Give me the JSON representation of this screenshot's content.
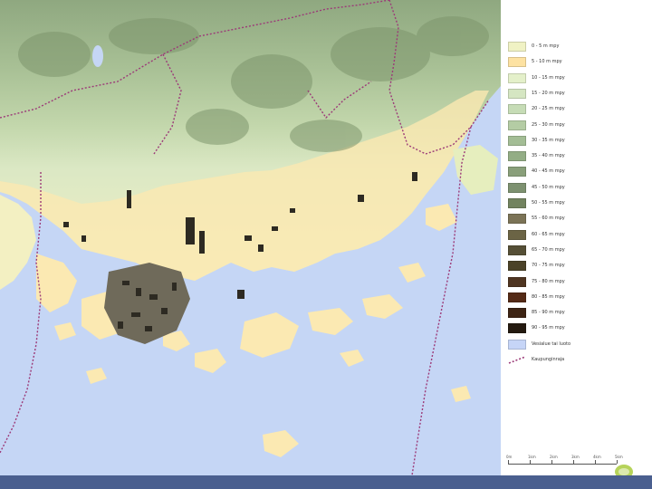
{
  "map": {
    "colors": {
      "water": "#c5d6f5",
      "coast_low": "#fbe9b2",
      "low_plain": "#f3f0c2",
      "green_1": "#dbe8c4",
      "green_2": "#c3d7ac",
      "green_3": "#a9c196",
      "green_4": "#8fa880",
      "buildings": "#2d2a22",
      "boundary": "#9c3a78"
    }
  },
  "legend": {
    "items": [
      {
        "label": "0 - 5 m mpy",
        "color": "#f0f2c4"
      },
      {
        "label": "5 - 10 m mpy",
        "color": "#fde2a2"
      },
      {
        "label": "10 - 15 m mpy",
        "color": "#e4f0ca"
      },
      {
        "label": "15 - 20 m mpy",
        "color": "#d5e6c2"
      },
      {
        "label": "20 - 25 m mpy",
        "color": "#c6dcb6"
      },
      {
        "label": "25 - 30 m mpy",
        "color": "#b4cca4"
      },
      {
        "label": "30 - 35 m mpy",
        "color": "#a3bd95"
      },
      {
        "label": "35 - 40 m mpy",
        "color": "#93ad85"
      },
      {
        "label": "40 - 45 m mpy",
        "color": "#899f7a"
      },
      {
        "label": "45 - 50 m mpy",
        "color": "#7d9170"
      },
      {
        "label": "50 - 55 m mpy",
        "color": "#72835f"
      },
      {
        "label": "55 - 60 m mpy",
        "color": "#7b7356"
      },
      {
        "label": "60 - 65 m mpy",
        "color": "#6b6445"
      },
      {
        "label": "65 - 70 m mpy",
        "color": "#554f36"
      },
      {
        "label": "70 - 75 m mpy",
        "color": "#4b4228"
      },
      {
        "label": "75 - 80 m mpy",
        "color": "#4f3521"
      },
      {
        "label": "80 - 85 m mpy",
        "color": "#542a16"
      },
      {
        "label": "85 - 90 m mpy",
        "color": "#3d2414"
      },
      {
        "label": "90 - 95 m mpy",
        "color": "#241a10"
      },
      {
        "label": "Vesialue tai luoto",
        "color": "#c6d5f7"
      },
      {
        "label": "Kaupunginraja",
        "color": "#9c3a78"
      }
    ]
  },
  "scale": {
    "labels": [
      "0m",
      "1km",
      "2km",
      "3km",
      "4km",
      "5km"
    ]
  },
  "footer": {
    "band_color": "#4a5f8f"
  }
}
